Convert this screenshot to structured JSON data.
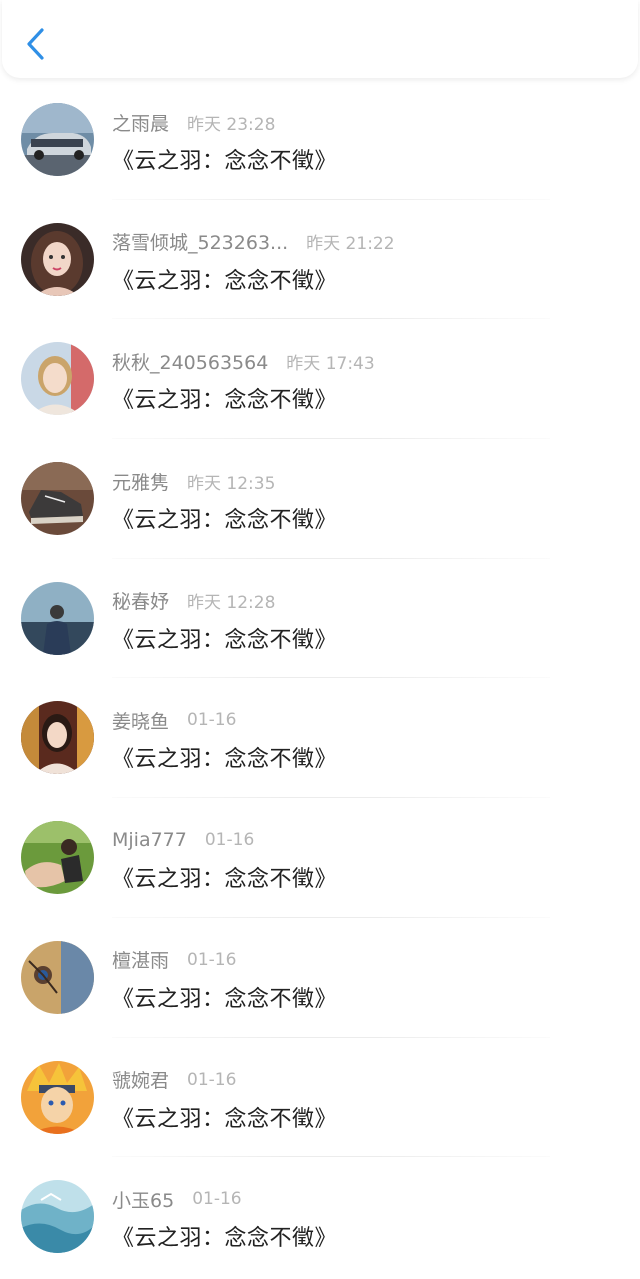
{
  "header": {
    "back_icon": "chevron-left-icon",
    "accent_color": "#2f8fe6"
  },
  "list": [
    {
      "name": "之雨晨",
      "time": "昨天 23:28",
      "message": "《云之羽：念念不徵》"
    },
    {
      "name": "落雪倾城_523263...",
      "time": "昨天 21:22",
      "message": "《云之羽：念念不徵》"
    },
    {
      "name": "秋秋_240563564",
      "time": "昨天 17:43",
      "message": "《云之羽：念念不徵》"
    },
    {
      "name": "元雅隽",
      "time": "昨天 12:35",
      "message": "《云之羽：念念不徵》"
    },
    {
      "name": "秘春妤",
      "time": "昨天 12:28",
      "message": "《云之羽：念念不徵》"
    },
    {
      "name": "姜晓鱼",
      "time": "01-16",
      "message": "《云之羽：念念不徵》"
    },
    {
      "name": "Mjia777",
      "time": "01-16",
      "message": "《云之羽：念念不徵》"
    },
    {
      "name": "檀湛雨",
      "time": "01-16",
      "message": "《云之羽：念念不徵》"
    },
    {
      "name": "虢婉君",
      "time": "01-16",
      "message": "《云之羽：念念不徵》"
    },
    {
      "name": "小玉65",
      "time": "01-16",
      "message": "《云之羽：念念不徵》"
    }
  ]
}
